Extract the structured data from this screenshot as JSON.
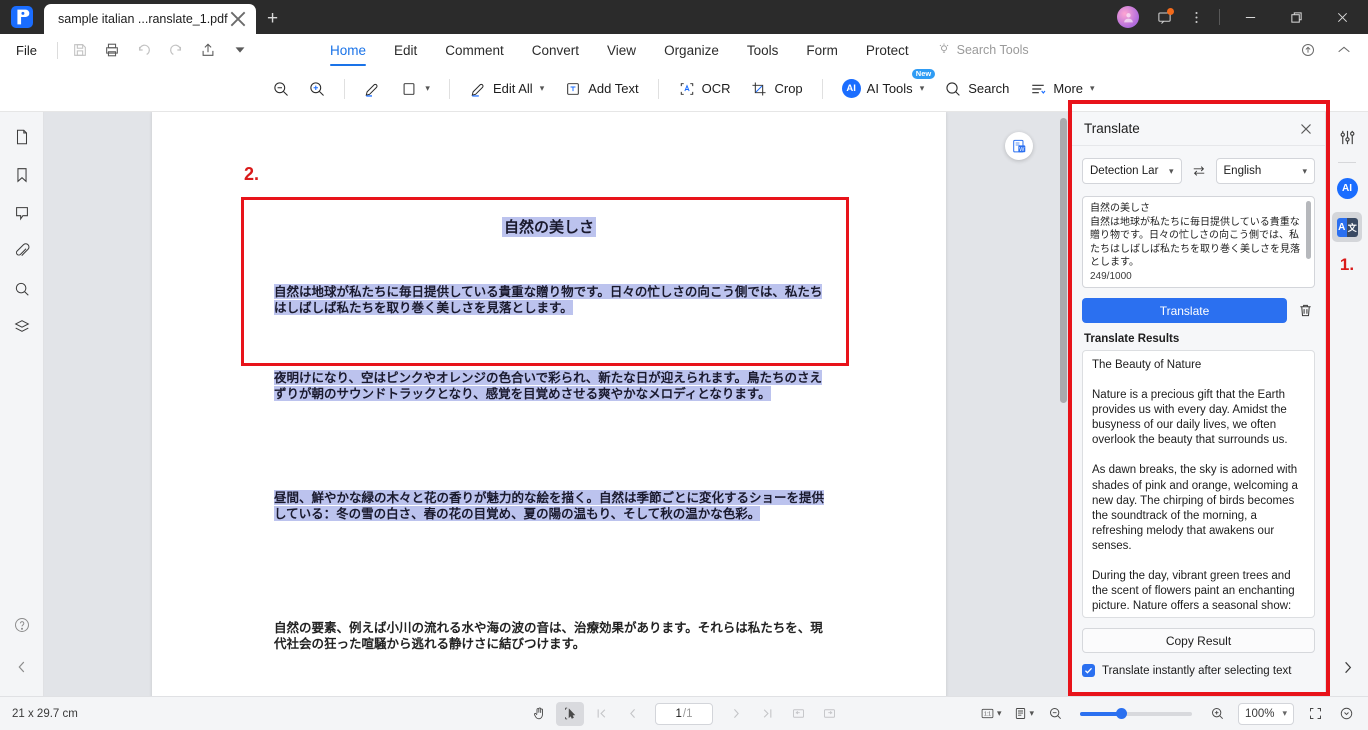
{
  "window": {
    "tab_title": "sample  italian ...ranslate_1.pdf",
    "new_tab_label": "+",
    "minimize": "—",
    "restore": "❐",
    "close": "✕"
  },
  "menu": {
    "file_label": "File",
    "quick_access": [
      "save-icon",
      "print-icon",
      "undo-icon",
      "redo-icon",
      "share-icon",
      "more-dropdown-icon"
    ],
    "ribbon_tabs": [
      {
        "label": "Home",
        "active": true
      },
      {
        "label": "Edit",
        "active": false
      },
      {
        "label": "Comment",
        "active": false
      },
      {
        "label": "Convert",
        "active": false
      },
      {
        "label": "View",
        "active": false
      },
      {
        "label": "Organize",
        "active": false
      },
      {
        "label": "Tools",
        "active": false
      },
      {
        "label": "Form",
        "active": false
      },
      {
        "label": "Protect",
        "active": false
      }
    ],
    "search_tools_label": "Search Tools"
  },
  "toolbar": {
    "zoom_out": "zoom-out-icon",
    "zoom_in": "zoom-in-icon",
    "highlight": "highlighter-icon",
    "shape_label": "",
    "edit_all_label": "Edit All",
    "add_text_label": "Add Text",
    "ocr_label": "OCR",
    "crop_label": "Crop",
    "ai_tools_label": "AI Tools",
    "ai_tools_badge": "New",
    "search_label": "Search",
    "more_label": "More"
  },
  "left_rail": {
    "items": [
      {
        "name": "thumbnails-icon"
      },
      {
        "name": "bookmark-icon"
      },
      {
        "name": "comment-icon"
      },
      {
        "name": "attachment-icon"
      },
      {
        "name": "search-icon"
      },
      {
        "name": "layers-icon"
      }
    ],
    "help": "?",
    "collapse": "‹"
  },
  "document": {
    "annotation_number": "2.",
    "title": "自然の美しさ",
    "paragraphs": [
      "自然は地球が私たちに毎日提供している貴重な贈り物です。日々の忙しさの向こう側では、私たちはしばしば私たちを取り巻く美しさを見落とします。",
      "夜明けになり、空はピンクやオレンジの色合いで彩られ、新たな日が迎えられます。鳥たちのさえずりが朝のサウンドトラックとなり、感覚を目覚めさせる爽やかなメロディとなります。",
      "昼間、鮮やかな緑の木々と花の香りが魅力的な絵を描く。自然は季節ごとに変化するショーを提供している：冬の雪の白さ、春の花の目覚め、夏の陽の温もり、そして秋の温かな色彩。",
      "自然の要素、例えば小川の流れる水や海の波の音は、治療効果があります。それらは私たちを、現代社会の狂った喧騒から逃れる静けさに結びつけます。"
    ],
    "convert_to_word_icon": "word-convert-icon"
  },
  "translate_panel": {
    "title": "Translate",
    "close_icon": "close-icon",
    "source_language": "Detection Lar",
    "swap_icon": "swap-languages-icon",
    "target_language": "English",
    "source_text": "自然の美しさ\n自然は地球が私たちに毎日提供している貴重な贈り物です。日々の忙しさの向こう側では、私たちはしばしば私たちを取り巻く美しさを見落とします。",
    "char_count": "249/1000",
    "translate_button": "Translate",
    "delete_icon": "trash-icon",
    "results_label": "Translate Results",
    "results_text": "The Beauty of Nature\n\nNature is a precious gift that the Earth provides us with every day. Amidst the busyness of our daily lives, we often overlook the beauty that surrounds us.\n\nAs dawn breaks, the sky is adorned with shades of pink and orange, welcoming a new day. The chirping of birds becomes the soundtrack of the morning, a refreshing melody that awakens our senses.\n\nDuring the day, vibrant green trees and the scent of flowers paint an enchanting picture. Nature offers a seasonal show:",
    "copy_button": "Copy Result",
    "checkbox_checked": true,
    "checkbox_label": "Translate instantly after selecting text"
  },
  "right_rail": {
    "settings_icon": "sliders-icon",
    "ai_label": "AI",
    "translate_a": "A",
    "translate_b": "文",
    "annotation_number": "1.",
    "expand": "›"
  },
  "statusbar": {
    "page_size": "21 x 29.7 cm",
    "hand_tool": "hand-tool-icon",
    "select_tool": "select-tool-icon",
    "first_page": "first-page-icon",
    "prev_page": "prev-page-icon",
    "current_page": "1",
    "total_pages": "/1",
    "next_page": "next-page-icon",
    "last_page": "last-page-icon",
    "fit_width_icon": "fit-width-icon",
    "fit_page_icon": "fit-page-icon",
    "actual_size_label": "1:1",
    "layout_icon": "page-layout-icon",
    "zoom_out_icon": "zoom-out-icon",
    "zoom_in_icon": "zoom-in-icon",
    "zoom_level": "100%",
    "fullscreen_icon": "fullscreen-icon",
    "more_icon": "chevron-down-circle-icon"
  },
  "colors": {
    "accent": "#2b70f0",
    "annotation_red": "#e8131a",
    "titlebar": "#2b2b2b",
    "selection": "#bcc3ee"
  }
}
